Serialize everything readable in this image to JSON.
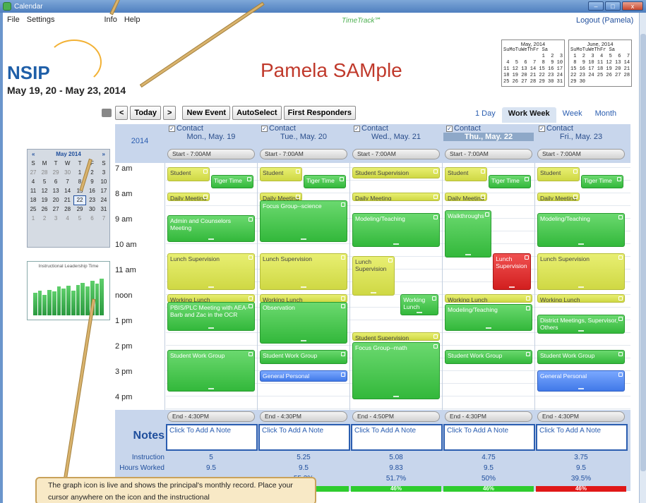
{
  "window": {
    "title": "Calendar",
    "controls": [
      "–",
      "□",
      "x"
    ]
  },
  "menu": [
    "File",
    "Settings",
    "Info",
    "Help"
  ],
  "brand": "TimeTrack℠",
  "logout": "Logout (Pamela)",
  "header": {
    "logo": "NSIP",
    "date_range": "May 19, 20   - May 23, 2014",
    "person": "Pamela SAMple"
  },
  "mini_calendars": [
    {
      "title": "May, 2014",
      "dow": "SuMoTuWeThFr Sa",
      "rows": [
        "             1  2  3",
        " 4  5  6  7  8  9 10",
        "11 12 13 14 15 16 17",
        "18 19 20 21 22 23 24",
        "25 26 27 28 29 30 31"
      ]
    },
    {
      "title": "June, 2014",
      "dow": "SuMoTuWeThFr Sa",
      "rows": [
        " 1  2  3  4  5  6  7",
        " 8  9 10 11 12 13 14",
        "15 16 17 18 19 20 21",
        "22 23 24 25 26 27 28",
        "29 30"
      ]
    }
  ],
  "toolbar": {
    "prev": "<",
    "today": "Today",
    "next": ">",
    "new_event": "New Event",
    "autoselect": "AutoSelect",
    "first_responders": "First Responders"
  },
  "views": [
    "1 Day",
    "Work Week",
    "Week",
    "Month"
  ],
  "active_view": "Work Week",
  "nav_calendar": {
    "prev": "«",
    "title": "May 2014",
    "next": "»",
    "dow": [
      "S",
      "M",
      "T",
      "W",
      "T",
      "F",
      "S"
    ],
    "weeks": [
      [
        "27",
        "28",
        "29",
        "30",
        "1",
        "2",
        "3"
      ],
      [
        "4",
        "5",
        "6",
        "7",
        "8",
        "9",
        "10"
      ],
      [
        "11",
        "12",
        "13",
        "14",
        "15",
        "16",
        "17"
      ],
      [
        "18",
        "19",
        "20",
        "21",
        "22",
        "23",
        "24"
      ],
      [
        "25",
        "26",
        "27",
        "28",
        "29",
        "30",
        "31"
      ],
      [
        "1",
        "2",
        "3",
        "4",
        "5",
        "6",
        "7"
      ]
    ],
    "selected": "22"
  },
  "ilt_graph": {
    "title": "Instructional Leadership Time",
    "values": [
      0.55,
      0.6,
      0.5,
      0.62,
      0.58,
      0.7,
      0.65,
      0.72,
      0.6,
      0.75,
      0.8,
      0.7,
      0.85,
      0.78,
      0.9
    ]
  },
  "year": "2014",
  "days": [
    {
      "contact": "Contact",
      "date": "Mon., May. 19",
      "start": "Start - 7:00AM",
      "end": "End - 4:30PM",
      "note": "Click To Add A Note",
      "instruction": "5",
      "hours": "9.5",
      "pct": "",
      "bar": "46%",
      "bar_color": "#2ecc2e"
    },
    {
      "contact": "Contact",
      "date": "Tue., May. 20",
      "start": "Start - 7:00AM",
      "end": "End - 4:30PM",
      "note": "Click To Add A Note",
      "instruction": "5.25",
      "hours": "9.5",
      "pct": "55.3%",
      "bar": "46%",
      "bar_color": "#2ecc2e"
    },
    {
      "contact": "Contact",
      "date": "Wed., May. 21",
      "start": "Start - 7:00AM",
      "end": "End - 4:50PM",
      "note": "Click To Add A Note",
      "instruction": "5.08",
      "hours": "9.83",
      "pct": "51.7%",
      "bar": "46%",
      "bar_color": "#2ecc2e"
    },
    {
      "contact": "Contact",
      "date": "Thu., May. 22",
      "start": "Start - 7:00AM",
      "end": "End - 4:30PM",
      "note": "Click To Add A Note",
      "instruction": "4.75",
      "hours": "9.5",
      "pct": "50%",
      "bar": "46%",
      "bar_color": "#2ecc2e"
    },
    {
      "contact": "Contact",
      "date": "Fri., May. 23",
      "start": "Start - 7:00AM",
      "end": "End - 4:30PM",
      "note": "Click To Add A Note",
      "instruction": "3.75",
      "hours": "9.5",
      "pct": "39.5%",
      "bar": "46%",
      "bar_color": "#e01818"
    }
  ],
  "hours": [
    "7 am",
    "8 am",
    "9 am",
    "10 am",
    "11 am",
    "noon",
    "1 pm",
    "2 pm",
    "3 pm",
    "4 pm"
  ],
  "events": [
    {
      "day": 0,
      "start": 7.0,
      "end": 7.6,
      "w": 0.5,
      "x": 0,
      "label": "Student",
      "c": "y"
    },
    {
      "day": 0,
      "start": 7.3,
      "end": 7.9,
      "w": 0.5,
      "x": 0.5,
      "label": "Tiger Time",
      "c": "g"
    },
    {
      "day": 0,
      "start": 8.0,
      "end": 8.4,
      "w": 0.5,
      "x": 0,
      "label": "Daily Meeting",
      "c": "y"
    },
    {
      "day": 0,
      "start": 8.9,
      "end": 10.0,
      "w": 1,
      "x": 0,
      "label": "Admin and Counselors Meeting",
      "c": "g"
    },
    {
      "day": 0,
      "start": 10.4,
      "end": 11.9,
      "w": 1,
      "x": 0,
      "label": "Lunch Supervision",
      "c": "y"
    },
    {
      "day": 0,
      "start": 12.0,
      "end": 12.3,
      "w": 1,
      "x": 0,
      "label": "Working Lunch",
      "c": "y"
    },
    {
      "day": 0,
      "start": 12.3,
      "end": 13.5,
      "w": 1,
      "x": 0,
      "label": "PBIS/PLC Meeting with AEA-Barb and Zac in the OCR",
      "c": "g"
    },
    {
      "day": 0,
      "start": 14.2,
      "end": 15.9,
      "w": 1,
      "x": 0,
      "label": "Student Work Group",
      "c": "g"
    },
    {
      "day": 1,
      "start": 7.0,
      "end": 7.6,
      "w": 0.5,
      "x": 0,
      "label": "Student",
      "c": "y"
    },
    {
      "day": 1,
      "start": 7.3,
      "end": 7.9,
      "w": 0.5,
      "x": 0.5,
      "label": "Tiger Time",
      "c": "g"
    },
    {
      "day": 1,
      "start": 8.0,
      "end": 8.3,
      "w": 0.5,
      "x": 0,
      "label": "Daily Meeting",
      "c": "y"
    },
    {
      "day": 1,
      "start": 8.3,
      "end": 10.0,
      "w": 1,
      "x": 0,
      "label": "Focus Group--science",
      "c": "g"
    },
    {
      "day": 1,
      "start": 10.4,
      "end": 11.9,
      "w": 1,
      "x": 0,
      "label": "Lunch Supervision",
      "c": "y"
    },
    {
      "day": 1,
      "start": 12.0,
      "end": 12.3,
      "w": 1,
      "x": 0,
      "label": "Working Lunch",
      "c": "y"
    },
    {
      "day": 1,
      "start": 12.3,
      "end": 14.0,
      "w": 1,
      "x": 0,
      "label": "Observation",
      "c": "g"
    },
    {
      "day": 1,
      "start": 14.2,
      "end": 14.8,
      "w": 1,
      "x": 0,
      "label": "Student Work Group",
      "c": "g"
    },
    {
      "day": 1,
      "start": 15.0,
      "end": 15.5,
      "w": 1,
      "x": 0,
      "label": "General Personal",
      "c": "b"
    },
    {
      "day": 2,
      "start": 7.0,
      "end": 7.5,
      "w": 1,
      "x": 0,
      "label": "Student Supervision",
      "c": "y"
    },
    {
      "day": 2,
      "start": 8.0,
      "end": 8.3,
      "w": 1,
      "x": 0,
      "label": "Daily Meeting",
      "c": "y"
    },
    {
      "day": 2,
      "start": 8.8,
      "end": 10.2,
      "w": 1,
      "x": 0,
      "label": "Modeling/Teaching",
      "c": "g"
    },
    {
      "day": 2,
      "start": 10.5,
      "end": 12.1,
      "w": 0.5,
      "x": 0,
      "label": "Lunch Supervision",
      "c": "y"
    },
    {
      "day": 2,
      "start": 12.0,
      "end": 12.9,
      "w": 0.45,
      "x": 0.55,
      "label": "Working Lunch",
      "c": "g"
    },
    {
      "day": 2,
      "start": 13.5,
      "end": 13.8,
      "w": 1,
      "x": 0,
      "label": "Student Supervision",
      "c": "y"
    },
    {
      "day": 2,
      "start": 13.9,
      "end": 16.2,
      "w": 1,
      "x": 0,
      "label": "Focus Group--math",
      "c": "g"
    },
    {
      "day": 3,
      "start": 7.0,
      "end": 7.6,
      "w": 0.5,
      "x": 0,
      "label": "Student",
      "c": "y"
    },
    {
      "day": 3,
      "start": 7.3,
      "end": 7.9,
      "w": 0.5,
      "x": 0.5,
      "label": "Tiger Time",
      "c": "g"
    },
    {
      "day": 3,
      "start": 8.0,
      "end": 8.3,
      "w": 0.5,
      "x": 0,
      "label": "Daily Meeting",
      "c": "y"
    },
    {
      "day": 3,
      "start": 8.7,
      "end": 10.6,
      "w": 0.55,
      "x": 0,
      "label": "Walkthroughs",
      "c": "g"
    },
    {
      "day": 3,
      "start": 10.4,
      "end": 11.9,
      "w": 0.45,
      "x": 0.55,
      "label": "Lunch Supervision",
      "c": "r"
    },
    {
      "day": 3,
      "start": 12.0,
      "end": 12.3,
      "w": 1,
      "x": 0,
      "label": "Working Lunch",
      "c": "y"
    },
    {
      "day": 3,
      "start": 12.4,
      "end": 13.5,
      "w": 1,
      "x": 0,
      "label": "Modeling/Teaching",
      "c": "g"
    },
    {
      "day": 3,
      "start": 14.2,
      "end": 14.8,
      "w": 1,
      "x": 0,
      "label": "Student Work Group",
      "c": "g"
    },
    {
      "day": 4,
      "start": 7.0,
      "end": 7.6,
      "w": 0.5,
      "x": 0,
      "label": "Student",
      "c": "y"
    },
    {
      "day": 4,
      "start": 7.3,
      "end": 7.9,
      "w": 0.5,
      "x": 0.5,
      "label": "Tiger Time",
      "c": "g"
    },
    {
      "day": 4,
      "start": 8.0,
      "end": 8.3,
      "w": 0.5,
      "x": 0,
      "label": "Daily Meeting",
      "c": "y"
    },
    {
      "day": 4,
      "start": 8.8,
      "end": 10.2,
      "w": 1,
      "x": 0,
      "label": "Modeling/Teaching",
      "c": "g"
    },
    {
      "day": 4,
      "start": 10.4,
      "end": 11.9,
      "w": 1,
      "x": 0,
      "label": "Lunch Supervision",
      "c": "y"
    },
    {
      "day": 4,
      "start": 12.0,
      "end": 12.3,
      "w": 1,
      "x": 0,
      "label": "Working Lunch",
      "c": "y"
    },
    {
      "day": 4,
      "start": 12.8,
      "end": 13.6,
      "w": 1,
      "x": 0,
      "label": "District Meetings, Supervisor, Others",
      "c": "g"
    },
    {
      "day": 4,
      "start": 14.2,
      "end": 14.8,
      "w": 1,
      "x": 0,
      "label": "Student Work Group",
      "c": "g"
    },
    {
      "day": 4,
      "start": 15.0,
      "end": 15.9,
      "w": 1,
      "x": 0,
      "label": "General Personal",
      "c": "b"
    }
  ],
  "notes_label": "Notes",
  "stat_labels": {
    "instruction": "Instruction",
    "hours": "Hours Worked"
  },
  "callout": "The graph icon is live and shows the principal's monthly record. Place your cursor anywhere on the icon and the instructional"
}
